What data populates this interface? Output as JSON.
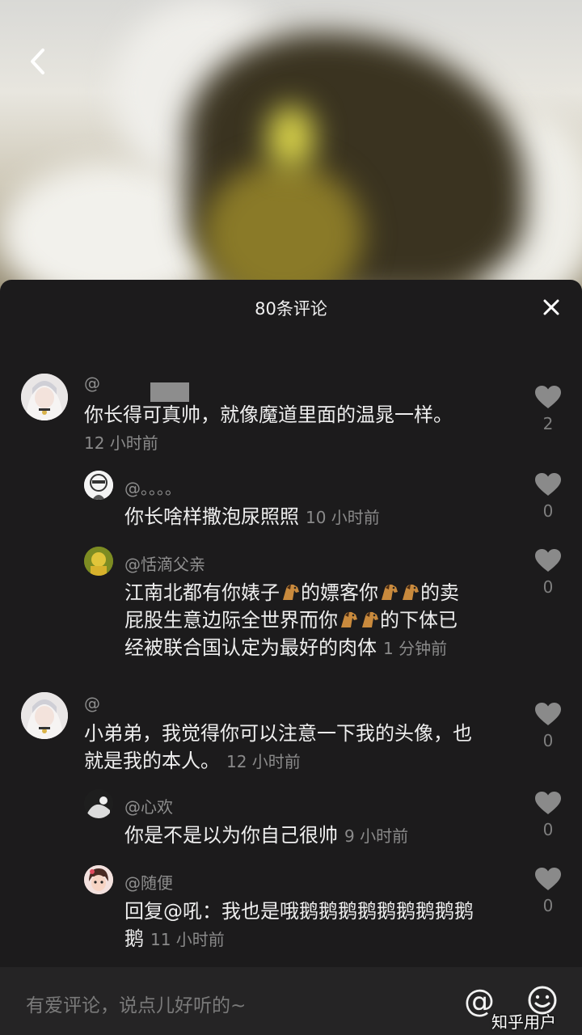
{
  "sheet": {
    "title": "80条评论"
  },
  "comments": [
    {
      "username": "@",
      "text": "你长得可真帅，就像魔道里面的温晁一样。",
      "time": "12 小时前",
      "likes": "2"
    },
    {
      "username": "@。。。。",
      "text": "你长啥样撒泡尿照照",
      "time": "10 小时前",
      "likes": "0"
    },
    {
      "username": "@恬滴父亲",
      "text_l1a": "江南北都有你婊子",
      "text_l1b": "的嫖客你",
      "text_l1c": "的卖",
      "text_l2a": "屁股生意边际全世界而你",
      "text_l2b": "的下体已",
      "text_l3": "经被联合国认定为最好的肉体",
      "time": "1 分钟前",
      "likes": "0"
    },
    {
      "username": "@",
      "text_l1": "小弟弟，我觉得你可以注意一下我的头像，也",
      "text_l2": "就是我的本人。",
      "time": "12 小时前",
      "likes": "0"
    },
    {
      "username": "@心欢",
      "text": "你是不是以为你自己很帅",
      "time": "9 小时前",
      "likes": "0"
    },
    {
      "username": "@随便",
      "text_l1": "回复@吼：我也是哦鹅鹅鹅鹅鹅鹅鹅鹅鹅",
      "text_l2": "鹅",
      "time": "11 小时前",
      "likes": "0"
    }
  ],
  "input": {
    "placeholder": "有爱评论，说点儿好听的~",
    "at_label": "@"
  },
  "watermark": "知乎用户"
}
